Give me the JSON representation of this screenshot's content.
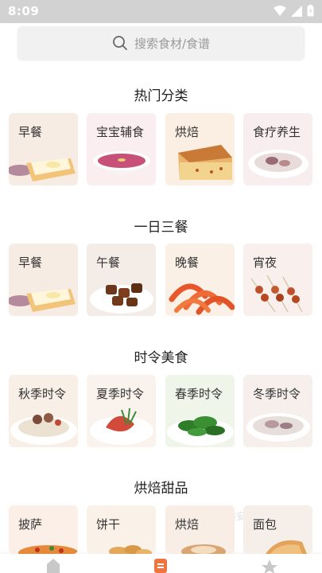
{
  "status": {
    "time": "8:09"
  },
  "search": {
    "placeholder": "搜索食材/食谱"
  },
  "sections": [
    {
      "title": "热门分类",
      "items": [
        "早餐",
        "宝宝辅食",
        "烘焙",
        "食疗养生"
      ]
    },
    {
      "title": "一日三餐",
      "items": [
        "早餐",
        "午餐",
        "晚餐",
        "宵夜"
      ]
    },
    {
      "title": "时令美食",
      "items": [
        "秋季时令",
        "夏季时令",
        "春季时令",
        "冬季时令"
      ]
    },
    {
      "title": "烘焙甜品",
      "items": [
        "披萨",
        "饼干",
        "烘焙",
        "面包"
      ]
    }
  ],
  "watermark": "5 18安卓网",
  "colors": {
    "accent": "#f0743e",
    "status_bar": "#d2d2d2"
  }
}
